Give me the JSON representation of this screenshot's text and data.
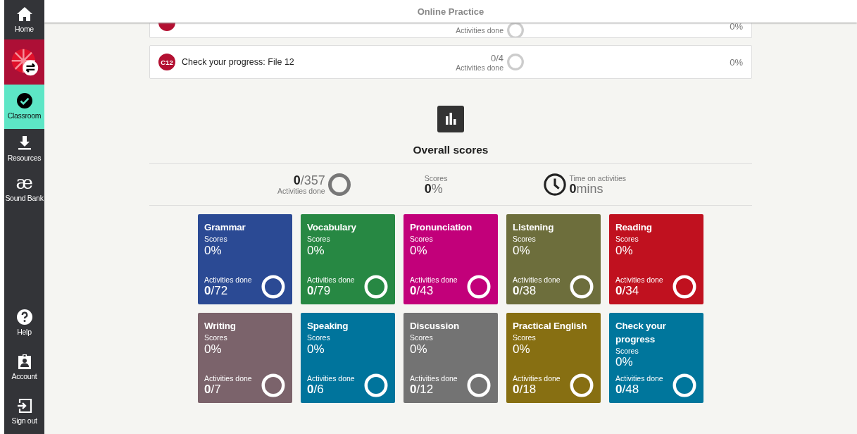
{
  "sidebar": {
    "items": [
      {
        "label": "Home",
        "selected": false
      },
      {
        "selected": false
      },
      {
        "label": "Classroom",
        "selected": true
      },
      {
        "label": "Resources",
        "selected": false
      },
      {
        "glyph": "æ",
        "label": "Sound Bank",
        "selected": false
      }
    ],
    "bottom_items": [
      {
        "label": "Help"
      },
      {
        "label": "Account"
      },
      {
        "label": "Sign out"
      }
    ]
  },
  "header": {
    "title": "Online Practice"
  },
  "lessons": [
    {
      "partial": true,
      "done_label": "Activities done",
      "score": "0%"
    },
    {
      "partial": false,
      "badge": "C12",
      "title": "Check your progress: File 12",
      "done": "0/4",
      "done_label": "Activities done",
      "score": "0%"
    }
  ],
  "overall": {
    "title": "Overall scores",
    "activities_value": "0",
    "activities_total": "/357",
    "activities_label": "Activities done",
    "scores_label": "Scores",
    "scores_value": "0",
    "scores_unit": "%",
    "time_label": "Time on activities",
    "time_value": "0",
    "time_unit": "mins"
  },
  "categories": [
    {
      "title": "Grammar",
      "color": "#2b4a94",
      "scores_label": "Scores",
      "score": "0%",
      "done_label": "Activities done",
      "done": "0",
      "total": "/72"
    },
    {
      "title": "Vocabulary",
      "color": "#278843",
      "scores_label": "Scores",
      "score": "0%",
      "done_label": "Activities done",
      "done": "0",
      "total": "/79"
    },
    {
      "title": "Pronunciation",
      "color": "#c2007a",
      "scores_label": "Scores",
      "score": "0%",
      "done_label": "Activities done",
      "done": "0",
      "total": "/43"
    },
    {
      "title": "Listening",
      "color": "#6d6e3c",
      "scores_label": "Scores",
      "score": "0%",
      "done_label": "Activities done",
      "done": "0",
      "total": "/38"
    },
    {
      "title": "Reading",
      "color": "#c0111f",
      "scores_label": "Scores",
      "score": "0%",
      "done_label": "Activities done",
      "done": "0",
      "total": "/34"
    },
    {
      "title": "Writing",
      "color": "#7b636b",
      "scores_label": "Scores",
      "score": "0%",
      "done_label": "Activities done",
      "done": "0",
      "total": "/7"
    },
    {
      "title": "Speaking",
      "color": "#00749c",
      "scores_label": "Scores",
      "score": "0%",
      "done_label": "Activities done",
      "done": "0",
      "total": "/6"
    },
    {
      "title": "Discussion",
      "color": "#737373",
      "scores_label": "Scores",
      "score": "0%",
      "done_label": "Activities done",
      "done": "0",
      "total": "/12"
    },
    {
      "title": "Practical English",
      "color": "#876f12",
      "scores_label": "Scores",
      "score": "0%",
      "done_label": "Activities done",
      "done": "0",
      "total": "/18"
    },
    {
      "title": "Check your progress",
      "color": "#00769c",
      "scores_label": "Scores",
      "score": "0%",
      "done_label": "Activities done",
      "done": "0",
      "total": "/48"
    }
  ]
}
